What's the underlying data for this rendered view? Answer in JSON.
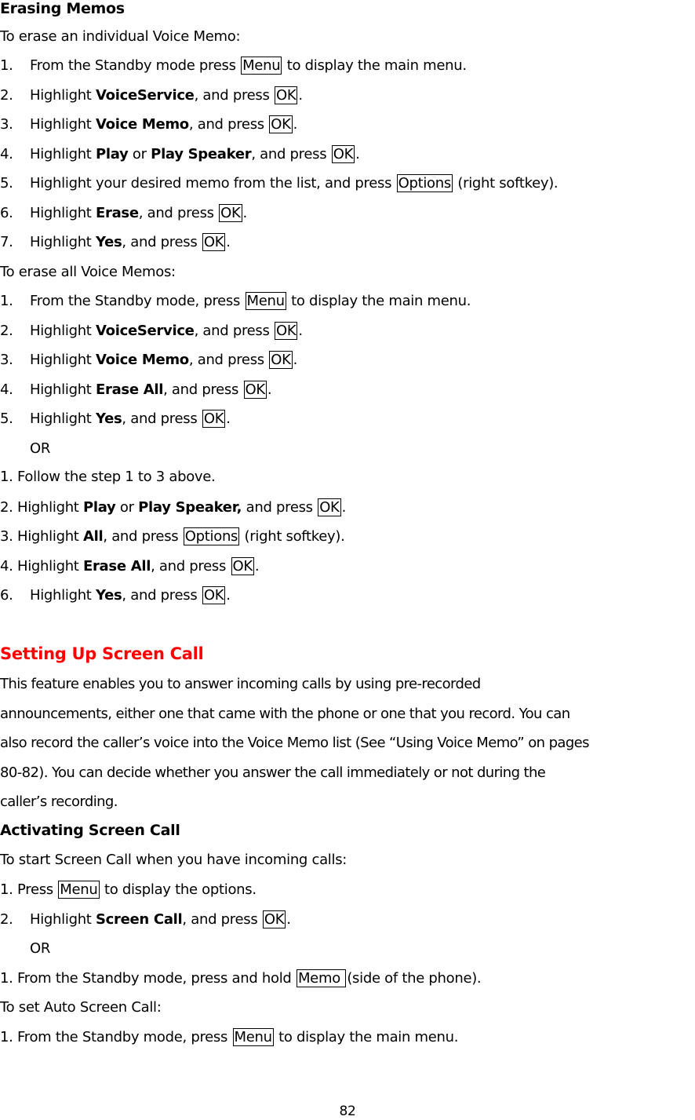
{
  "section1": {
    "title": "Erasing Memos",
    "intro_individual": "To erase an individual Voice Memo:",
    "individual_steps": [
      {
        "num": "1.",
        "pre": "From the Standby mode press ",
        "key": "Menu",
        "post": " to display the main menu."
      },
      {
        "num": "2.",
        "pre": "Highlight ",
        "bold": "VoiceService",
        "mid": ", and press ",
        "key": "OK",
        "post": "."
      },
      {
        "num": "3.",
        "pre": "Highlight ",
        "bold": "Voice Memo",
        "mid": ", and press ",
        "key": "OK",
        "post": "."
      },
      {
        "num": "4.",
        "pre": "Highlight ",
        "bold": "Play",
        "or": " or ",
        "bold2": "Play Speaker",
        "mid": ", and press ",
        "key": "OK",
        "post": "."
      },
      {
        "num": "5.",
        "pre": "Highlight your desired memo from the list, and press ",
        "key": "Options",
        "post": " (right softkey)."
      },
      {
        "num": "6.",
        "pre": "Highlight ",
        "bold": "Erase",
        "mid": ", and press ",
        "key": "OK",
        "post": "."
      },
      {
        "num": "7.",
        "pre": "Highlight ",
        "bold": "Yes",
        "mid": ", and press ",
        "key": "OK",
        "post": "."
      }
    ],
    "intro_all": "To erase all Voice Memos:",
    "all_steps": [
      {
        "num": "1.",
        "pre": "From the Standby mode, press ",
        "key": "Menu",
        "post": " to display the main menu."
      },
      {
        "num": "2.",
        "pre": "Highlight ",
        "bold": "VoiceService",
        "mid": ", and press ",
        "key": "OK",
        "post": "."
      },
      {
        "num": "3.",
        "pre": "Highlight ",
        "bold": "Voice Memo",
        "mid": ", and press ",
        "key": "OK",
        "post": "."
      },
      {
        "num": "4.",
        "pre": "Highlight ",
        "bold": "Erase All",
        "mid": ", and press ",
        "key": "OK",
        "post": "."
      },
      {
        "num": "5.",
        "pre": "Highlight ",
        "bold": "Yes",
        "mid": ", and press ",
        "key": "OK",
        "post": "."
      }
    ],
    "or_label": "OR",
    "alt_steps": [
      {
        "text": "1. Follow the step 1 to 3 above."
      },
      {
        "pre": "2. Highlight ",
        "bold": "Play",
        "or": " or ",
        "bold2": "Play Speaker,",
        "mid": " and press ",
        "key": "OK",
        "post": "."
      },
      {
        "pre": "3. Highlight ",
        "bold": "All",
        "mid": ", and press ",
        "key": "Options",
        "post": " (right softkey)."
      },
      {
        "pre": "4. Highlight ",
        "bold": "Erase All",
        "mid": ", and press ",
        "key": "OK",
        "post": "."
      },
      {
        "num": "6.",
        "pre": "Highlight ",
        "bold": "Yes",
        "mid": ", and press ",
        "key": "OK",
        "post": "."
      }
    ]
  },
  "section2": {
    "title": "Setting Up Screen Call",
    "title_color": "#ff0000",
    "description_lines": [
      "This feature enables you to answer incoming calls by using pre-recorded",
      "announcements, either one that came with the phone or one that you record. You can",
      "also record the caller’s voice into the Voice Memo list (See “Using Voice Memo” on pages",
      "80-82). You can decide whether you answer the call immediately or not during the",
      "caller’s recording."
    ],
    "subtitle": "Activating Screen Call",
    "intro_start": "To start Screen Call when you have incoming calls:",
    "start_steps": [
      {
        "pre": "1. Press ",
        "key": "Menu",
        "post": " to display the options."
      },
      {
        "num": "2.",
        "pre": "Highlight ",
        "bold": "Screen Call",
        "mid": ", and press ",
        "key": "OK",
        "post": "."
      }
    ],
    "or_label": "OR",
    "alt_step": {
      "pre": "1. From the Standby mode, press and hold ",
      "key": "Memo ",
      "post": "(side of the phone)."
    },
    "intro_auto": "To set Auto Screen Call:",
    "auto_step": {
      "pre": "1. From the Standby mode, press ",
      "key": "Menu",
      "post": " to display the main menu."
    }
  },
  "footer": {
    "page_number": "82"
  }
}
